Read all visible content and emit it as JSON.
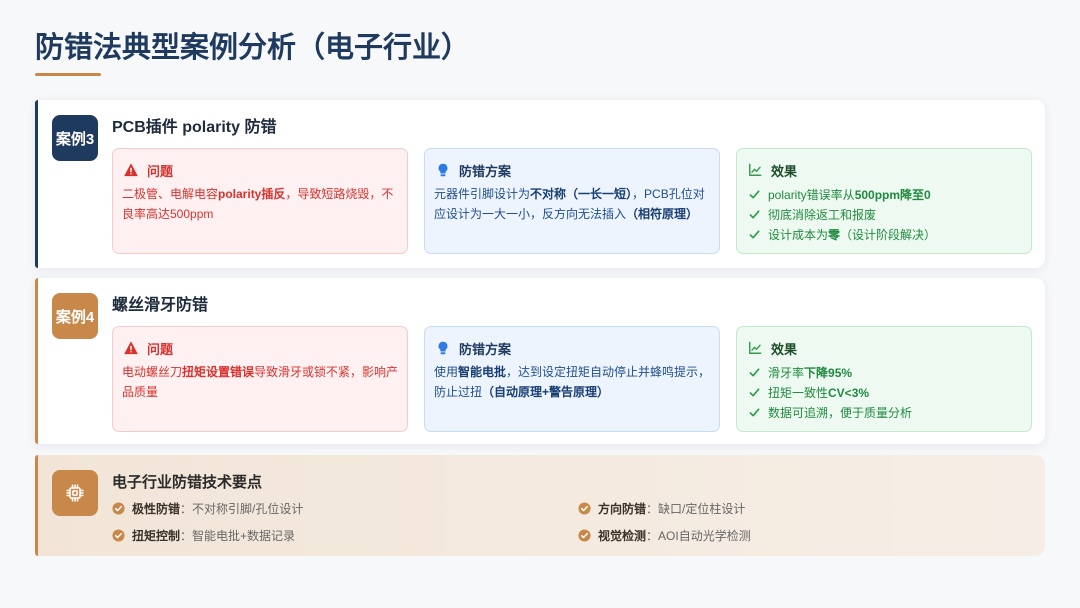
{
  "title": "防错法典型案例分析（电子行业）",
  "colors": {
    "navy": "#1f3a5f",
    "accent": "#c8884a",
    "problem": "#d6332f",
    "solution": "#1f4e8c",
    "effect": "#1f8a3e",
    "background": "#f7f8fa"
  },
  "cases": [
    {
      "badge": "案例3",
      "heading": "PCB插件 polarity 防错",
      "problem": {
        "icon": "warning-icon",
        "label": "问题",
        "text": [
          "二极管、电解电容",
          "polarity插反",
          "，导致短路烧毁，不良率高达500ppm"
        ]
      },
      "solution": {
        "icon": "lightbulb-icon",
        "label": "防错方案",
        "text": [
          "元器件引脚设计为",
          "不对称（一长一短）",
          "，PCB孔位对应设计为一大一小，反方向无法插入",
          "（相符原理）"
        ]
      },
      "effect": {
        "icon": "chart-line-icon",
        "label": "效果",
        "items": [
          [
            "polarity错误率从",
            "500ppm降至0"
          ],
          [
            "彻底消除返工和报废"
          ],
          [
            "设计成本为",
            "零",
            "（设计阶段解决）"
          ]
        ]
      }
    },
    {
      "badge": "案例4",
      "heading": "螺丝滑牙防错",
      "problem": {
        "icon": "warning-icon",
        "label": "问题",
        "text": [
          "电动螺丝刀",
          "扭矩设置错误",
          "导致滑牙或锁不紧，影响产品质量"
        ]
      },
      "solution": {
        "icon": "lightbulb-icon",
        "label": "防错方案",
        "text": [
          "使用",
          "智能电批",
          "，达到设定扭矩自动停止并蜂鸣提示，防止过扭",
          "（自动原理+警告原理）"
        ]
      },
      "effect": {
        "icon": "chart-line-icon",
        "label": "效果",
        "items": [
          [
            "滑牙率",
            "下降95%"
          ],
          [
            "扭矩一致性",
            "CV<3%"
          ],
          [
            "数据可追溯，便于质量分析"
          ]
        ]
      }
    }
  ],
  "summary": {
    "icon": "chip-icon",
    "heading": "电子行业防错技术要点",
    "points": [
      {
        "label": "极性防错",
        "text": "：不对称引脚/孔位设计"
      },
      {
        "label": "方向防错",
        "text": "：缺口/定位柱设计"
      },
      {
        "label": "扭矩控制",
        "text": "：智能电批+数据记录"
      },
      {
        "label": "视觉检测",
        "text": "：AOI自动光学检测"
      }
    ]
  }
}
